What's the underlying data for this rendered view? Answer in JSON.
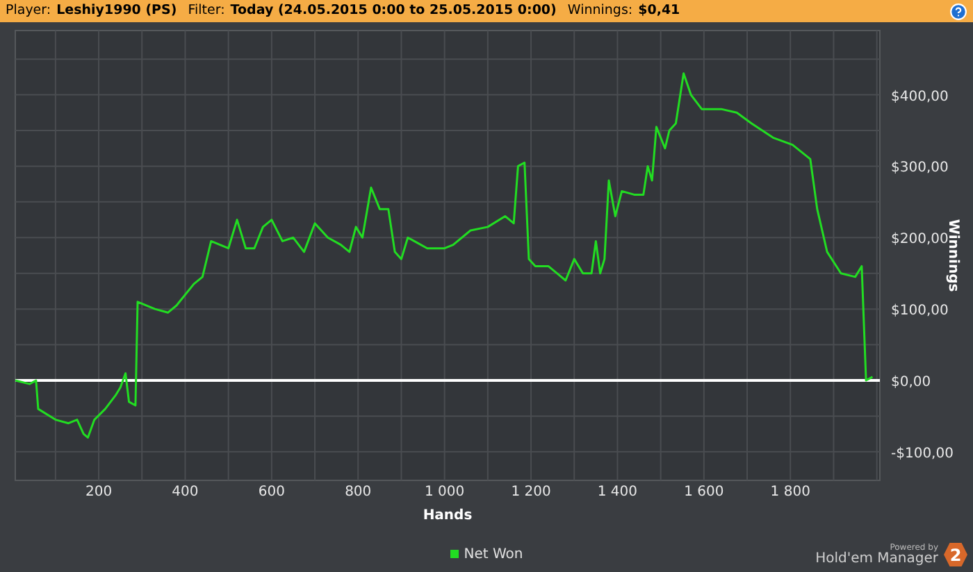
{
  "header": {
    "player_label": "Player:",
    "player": "Leshiy1990 (PS)",
    "filter_label": "Filter:",
    "filter": "Today (24.05.2015 0:00 to 25.05.2015 0:00)",
    "winnings_label": "Winnings:",
    "winnings": "$0,41"
  },
  "chart": {
    "chart_data": {
      "type": "line",
      "xlabel": "Hands",
      "ylabel": "Winnings",
      "xlim": [
        7,
        2007
      ],
      "ylim": [
        -140,
        490
      ],
      "xticks": [
        {
          "value": 200,
          "label": "200"
        },
        {
          "value": 400,
          "label": "400"
        },
        {
          "value": 600,
          "label": "600"
        },
        {
          "value": 800,
          "label": "800"
        },
        {
          "value": 1000,
          "label": "1 000"
        },
        {
          "value": 1200,
          "label": "1 200"
        },
        {
          "value": 1400,
          "label": "1 400"
        },
        {
          "value": 1600,
          "label": "1 600"
        },
        {
          "value": 1800,
          "label": "1 800"
        }
      ],
      "yticks": [
        {
          "value": -100,
          "label": "-$100,00"
        },
        {
          "value": 0,
          "label": "$0,00"
        },
        {
          "value": 100,
          "label": "$100,00"
        },
        {
          "value": 200,
          "label": "$200,00"
        },
        {
          "value": 300,
          "label": "$300,00"
        },
        {
          "value": 400,
          "label": "$400,00"
        }
      ],
      "x": [
        7,
        40,
        55,
        60,
        100,
        130,
        150,
        165,
        175,
        190,
        215,
        240,
        250,
        262,
        270,
        285,
        290,
        330,
        360,
        380,
        420,
        440,
        460,
        500,
        520,
        540,
        560,
        580,
        600,
        625,
        650,
        675,
        700,
        730,
        760,
        780,
        795,
        810,
        830,
        850,
        870,
        885,
        900,
        915,
        930,
        960,
        1000,
        1020,
        1060,
        1100,
        1140,
        1160,
        1170,
        1185,
        1195,
        1210,
        1240,
        1260,
        1280,
        1300,
        1320,
        1340,
        1350,
        1360,
        1370,
        1380,
        1395,
        1410,
        1440,
        1460,
        1470,
        1480,
        1490,
        1510,
        1520,
        1535,
        1553,
        1570,
        1595,
        1640,
        1676,
        1710,
        1760,
        1805,
        1846,
        1862,
        1885,
        1917,
        1950,
        1965,
        1975,
        1990
      ],
      "series": [
        {
          "name": "Net Won",
          "color": "#22dd22",
          "values": [
            0,
            -5,
            0,
            -40,
            -55,
            -60,
            -55,
            -75,
            -80,
            -55,
            -40,
            -20,
            -10,
            10,
            -30,
            -35,
            110,
            100,
            95,
            105,
            135,
            145,
            195,
            185,
            225,
            185,
            185,
            215,
            225,
            195,
            200,
            180,
            220,
            200,
            190,
            180,
            215,
            200,
            270,
            240,
            240,
            180,
            170,
            200,
            195,
            185,
            185,
            190,
            210,
            215,
            230,
            220,
            300,
            305,
            170,
            160,
            160,
            150,
            140,
            170,
            150,
            150,
            195,
            150,
            170,
            280,
            230,
            265,
            260,
            260,
            300,
            280,
            355,
            325,
            350,
            360,
            430,
            400,
            380,
            380,
            375,
            360,
            340,
            330,
            310,
            240,
            180,
            150,
            145,
            160,
            0,
            5
          ]
        }
      ],
      "grid": true,
      "ref_lines": [
        {
          "axis": "y",
          "value": 0
        }
      ]
    }
  },
  "branding": {
    "tagline": "Powered by",
    "product": "Hold'em Manager",
    "version": "2"
  }
}
